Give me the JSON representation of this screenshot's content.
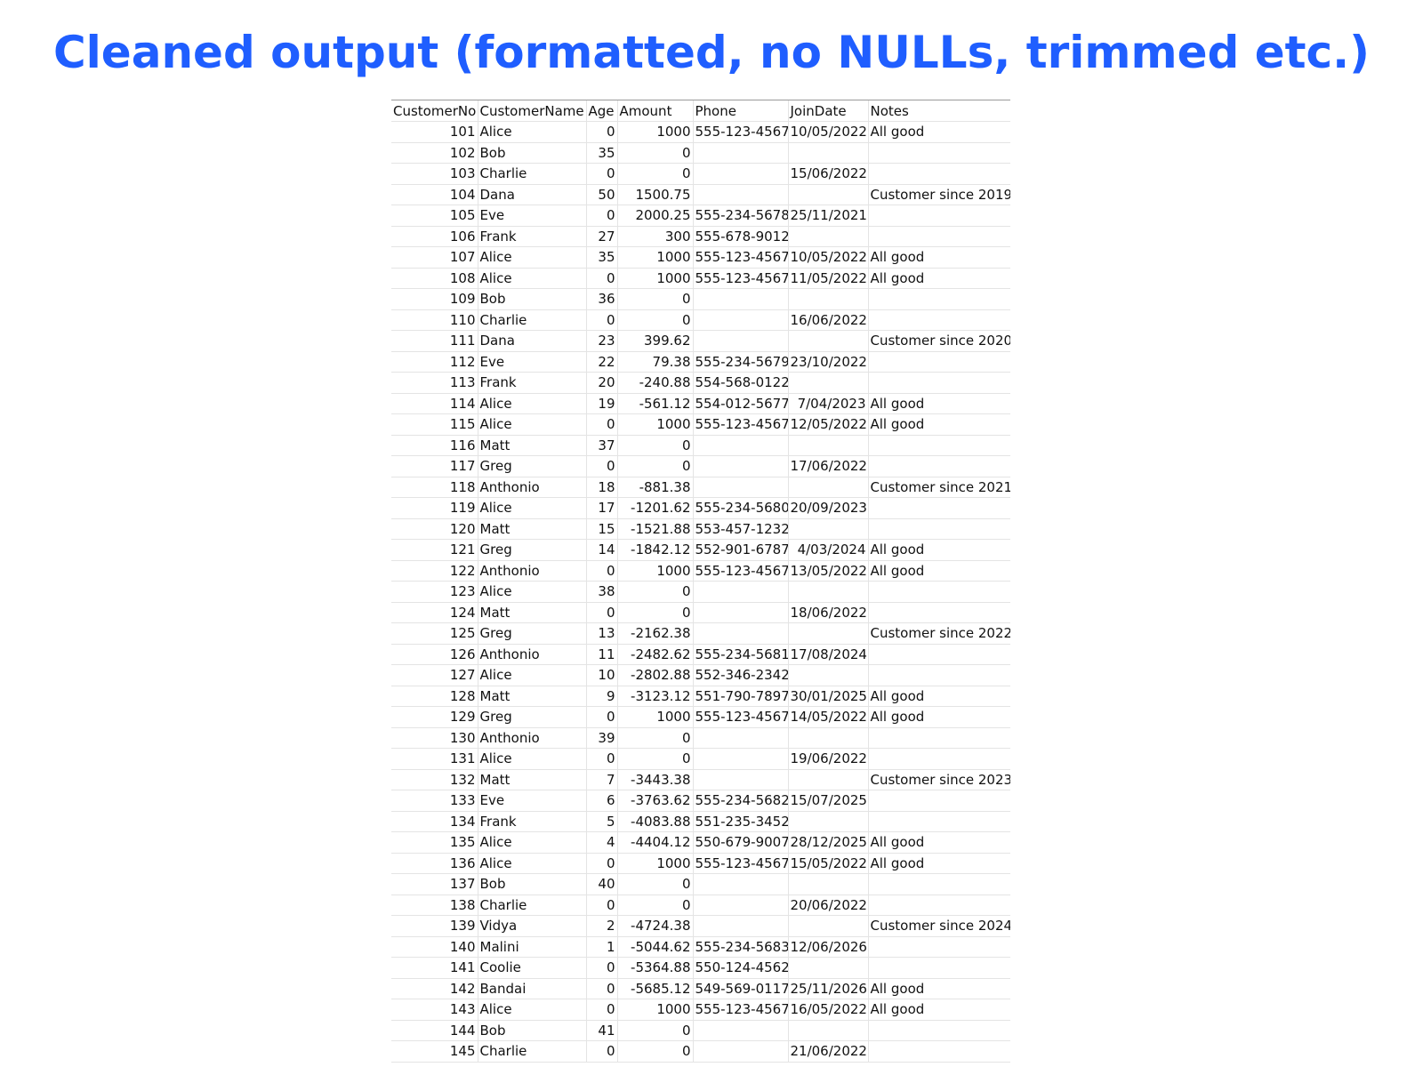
{
  "title": "Cleaned output (formatted, no NULLs, trimmed etc.)",
  "columns": [
    "CustomerNo",
    "CustomerName",
    "Age",
    "Amount",
    "Phone",
    "JoinDate",
    "Notes"
  ],
  "rows": [
    [
      "101",
      "Alice",
      "0",
      "1000",
      "555-123-4567",
      "10/05/2022",
      "All good"
    ],
    [
      "102",
      "Bob",
      "35",
      "0",
      "",
      "",
      ""
    ],
    [
      "103",
      "Charlie",
      "0",
      "0",
      "",
      "15/06/2022",
      ""
    ],
    [
      "104",
      "Dana",
      "50",
      "1500.75",
      "",
      "",
      "Customer since 2019"
    ],
    [
      "105",
      "Eve",
      "0",
      "2000.25",
      "555-234-5678",
      "25/11/2021",
      ""
    ],
    [
      "106",
      "Frank",
      "27",
      "300",
      "555-678-9012",
      "",
      ""
    ],
    [
      "107",
      "Alice",
      "35",
      "1000",
      "555-123-4567",
      "10/05/2022",
      "All good"
    ],
    [
      "108",
      "Alice",
      "0",
      "1000",
      "555-123-4567",
      "11/05/2022",
      "All good"
    ],
    [
      "109",
      "Bob",
      "36",
      "0",
      "",
      "",
      ""
    ],
    [
      "110",
      "Charlie",
      "0",
      "0",
      "",
      "16/06/2022",
      ""
    ],
    [
      "111",
      "Dana",
      "23",
      "399.62",
      "",
      "",
      "Customer since 2020"
    ],
    [
      "112",
      "Eve",
      "22",
      "79.38",
      "555-234-5679",
      "23/10/2022",
      ""
    ],
    [
      "113",
      "Frank",
      "20",
      "-240.88",
      "554-568-0122",
      "",
      ""
    ],
    [
      "114",
      "Alice",
      "19",
      "-561.12",
      "554-012-5677",
      "7/04/2023",
      "All good"
    ],
    [
      "115",
      "Alice",
      "0",
      "1000",
      "555-123-4567",
      "12/05/2022",
      "All good"
    ],
    [
      "116",
      "Matt",
      "37",
      "0",
      "",
      "",
      ""
    ],
    [
      "117",
      "Greg",
      "0",
      "0",
      "",
      "17/06/2022",
      ""
    ],
    [
      "118",
      "Anthonio",
      "18",
      "-881.38",
      "",
      "",
      "Customer since 2021"
    ],
    [
      "119",
      "Alice",
      "17",
      "-1201.62",
      "555-234-5680",
      "20/09/2023",
      ""
    ],
    [
      "120",
      "Matt",
      "15",
      "-1521.88",
      "553-457-1232",
      "",
      ""
    ],
    [
      "121",
      "Greg",
      "14",
      "-1842.12",
      "552-901-6787",
      "4/03/2024",
      "All good"
    ],
    [
      "122",
      "Anthonio",
      "0",
      "1000",
      "555-123-4567",
      "13/05/2022",
      "All good"
    ],
    [
      "123",
      "Alice",
      "38",
      "0",
      "",
      "",
      ""
    ],
    [
      "124",
      "Matt",
      "0",
      "0",
      "",
      "18/06/2022",
      ""
    ],
    [
      "125",
      "Greg",
      "13",
      "-2162.38",
      "",
      "",
      "Customer since 2022"
    ],
    [
      "126",
      "Anthonio",
      "11",
      "-2482.62",
      "555-234-5681",
      "17/08/2024",
      ""
    ],
    [
      "127",
      "Alice",
      "10",
      "-2802.88",
      "552-346-2342",
      "",
      ""
    ],
    [
      "128",
      "Matt",
      "9",
      "-3123.12",
      "551-790-7897",
      "30/01/2025",
      "All good"
    ],
    [
      "129",
      "Greg",
      "0",
      "1000",
      "555-123-4567",
      "14/05/2022",
      "All good"
    ],
    [
      "130",
      "Anthonio",
      "39",
      "0",
      "",
      "",
      ""
    ],
    [
      "131",
      "Alice",
      "0",
      "0",
      "",
      "19/06/2022",
      ""
    ],
    [
      "132",
      "Matt",
      "7",
      "-3443.38",
      "",
      "",
      "Customer since 2023"
    ],
    [
      "133",
      "Eve",
      "6",
      "-3763.62",
      "555-234-5682",
      "15/07/2025",
      ""
    ],
    [
      "134",
      "Frank",
      "5",
      "-4083.88",
      "551-235-3452",
      "",
      ""
    ],
    [
      "135",
      "Alice",
      "4",
      "-4404.12",
      "550-679-9007",
      "28/12/2025",
      "All good"
    ],
    [
      "136",
      "Alice",
      "0",
      "1000",
      "555-123-4567",
      "15/05/2022",
      "All good"
    ],
    [
      "137",
      "Bob",
      "40",
      "0",
      "",
      "",
      ""
    ],
    [
      "138",
      "Charlie",
      "0",
      "0",
      "",
      "20/06/2022",
      ""
    ],
    [
      "139",
      "Vidya",
      "2",
      "-4724.38",
      "",
      "",
      "Customer since 2024"
    ],
    [
      "140",
      "Malini",
      "1",
      "-5044.62",
      "555-234-5683",
      "12/06/2026",
      ""
    ],
    [
      "141",
      "Coolie",
      "0",
      "-5364.88",
      "550-124-4562",
      "",
      ""
    ],
    [
      "142",
      "Bandai",
      "0",
      "-5685.12",
      "549-569-0117",
      "25/11/2026",
      "All good"
    ],
    [
      "143",
      "Alice",
      "0",
      "1000",
      "555-123-4567",
      "16/05/2022",
      "All good"
    ],
    [
      "144",
      "Bob",
      "41",
      "0",
      "",
      "",
      ""
    ],
    [
      "145",
      "Charlie",
      "0",
      "0",
      "",
      "21/06/2022",
      ""
    ]
  ]
}
